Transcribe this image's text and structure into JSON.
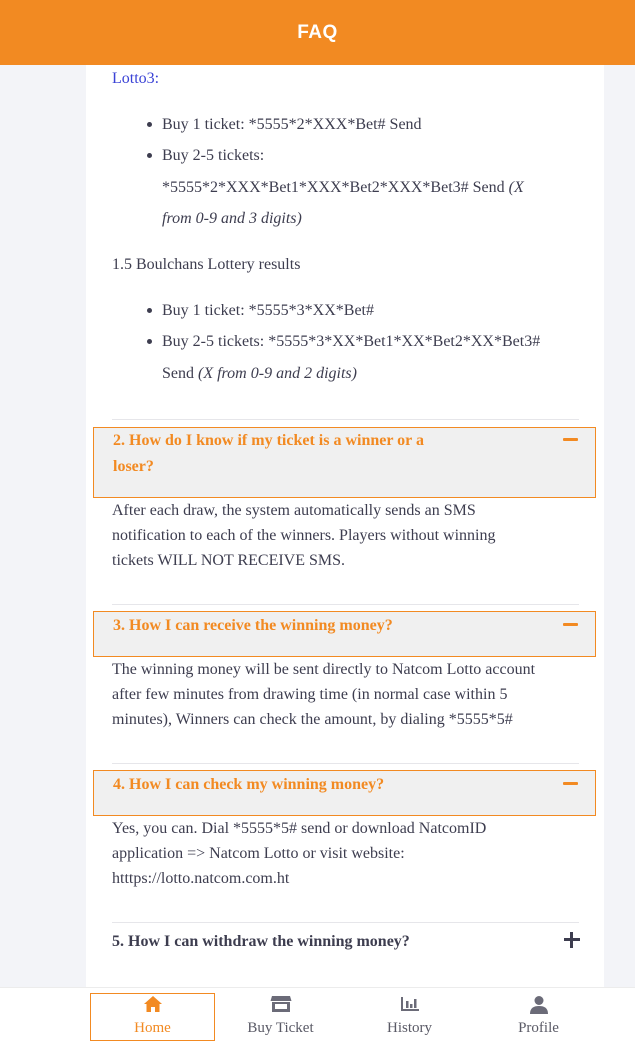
{
  "header": {
    "title": "FAQ"
  },
  "section1": {
    "lotto3_label": "Lotto3:",
    "lotto3_items": [
      {
        "text": "Buy 1 ticket: *5555*2*XXX*Bet# Send"
      },
      {
        "line1": "Buy 2-5 tickets:",
        "line2": "*5555*2*XXX*Bet1*XXX*Bet2*XXX*Bet3# Send ",
        "note_a": "(X",
        "note_b": "from 0-9 and 3 digits)"
      }
    ],
    "boulchans_heading": "1.5 Boulchans Lottery results",
    "boulchans_items": [
      {
        "text": "Buy 1 ticket: *5555*3*XX*Bet#"
      },
      {
        "line1": "Buy 2-5 tickets: *5555*3*XX*Bet1*XX*Bet2*XX*Bet3#",
        "line2": "Send ",
        "note": "(X from 0-9 and 2 digits)"
      }
    ]
  },
  "faqs": [
    {
      "question_line1": "2. How do I know if my ticket is a winner or a",
      "question_line2": "loser?",
      "expanded": true,
      "answer_lines": [
        "After each draw, the system automatically sends an SMS",
        "notification to each of the winners. Players without winning",
        "tickets WILL NOT RECEIVE SMS."
      ]
    },
    {
      "question": "3. How I can receive the winning money?",
      "expanded": true,
      "answer_lines": [
        "The winning money will be sent directly to Natcom Lotto account",
        "after few minutes from drawing time (in normal case within 5",
        "minutes), Winners can check the amount, by dialing *5555*5#"
      ]
    },
    {
      "question": "4. How I can check my winning money?",
      "expanded": true,
      "answer_lines": [
        "Yes, you can. Dial *5555*5# send or download NatcomID",
        "application => Natcom Lotto or visit website:",
        "htttps://lotto.natcom.com.ht"
      ]
    },
    {
      "question": "5. How I can withdraw the winning money?",
      "expanded": false
    }
  ],
  "bottom_nav": [
    {
      "label": "Home",
      "icon": "home-icon",
      "active": true
    },
    {
      "label": "Buy Ticket",
      "icon": "store-icon",
      "active": false
    },
    {
      "label": "History",
      "icon": "bar-chart-icon",
      "active": false
    },
    {
      "label": "Profile",
      "icon": "user-icon",
      "active": false
    }
  ],
  "colors": {
    "accent": "#f28a22",
    "link": "#3a42d6",
    "text": "#3d3d4f"
  }
}
